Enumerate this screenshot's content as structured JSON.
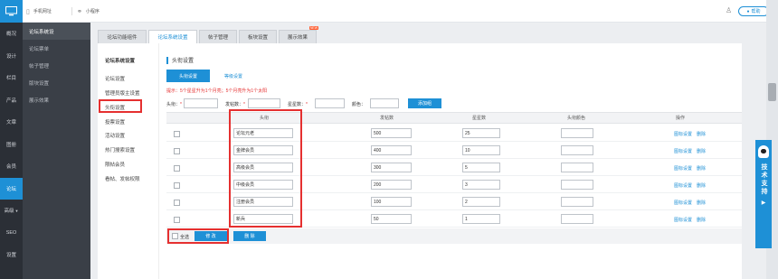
{
  "nav": {
    "items": [
      "概况",
      "设计",
      "栏目",
      "产品",
      "文章",
      "图册",
      "会员",
      "论坛",
      "高级",
      "SEO",
      "设置"
    ],
    "active_index": 7
  },
  "sub_nav": {
    "title": "论坛",
    "items": [
      "论坛系统设",
      "论坛票单",
      "帖子管理",
      "版块设置",
      "展示效果"
    ],
    "active_index": 0
  },
  "topbar": {
    "mobile_label": "手机网址",
    "miniapp_label": "小程序",
    "help_label": "帮助"
  },
  "tabs": [
    {
      "label": "论坛功能组件"
    },
    {
      "label": "论坛系统设置"
    },
    {
      "label": "帖子管理"
    },
    {
      "label": "板块设置"
    },
    {
      "label": "展示效果",
      "badge": "NEW"
    }
  ],
  "active_tab": 1,
  "left_menu": {
    "title": "论坛系统设置",
    "items": [
      "论坛设置",
      "管理员版主设置",
      "头衔设置",
      "投票设置",
      "活动设置",
      "热门搜索设置",
      "限帖会员",
      "看帖、发帖权限"
    ],
    "active_index": 2
  },
  "section": {
    "title": "头衔设置",
    "subtabs": [
      "头衔设置",
      "等级设置"
    ],
    "hint": "提示：5个星星升为1个月亮；5个月亮升为1个太阳"
  },
  "form": {
    "title_label": "头衔：",
    "posts_label": "发帖数：",
    "stars_label": "星星数：",
    "color_label": "颜色：",
    "add_button": "添加组"
  },
  "table": {
    "headers": [
      "头衔",
      "发帖数",
      "星星数",
      "头衔颜色",
      "操作"
    ],
    "rows": [
      {
        "title": "论坛元老",
        "posts": "500",
        "stars": "25"
      },
      {
        "title": "金牌会员",
        "posts": "400",
        "stars": "10"
      },
      {
        "title": "高级会员",
        "posts": "300",
        "stars": "5"
      },
      {
        "title": "中级会员",
        "posts": "200",
        "stars": "3"
      },
      {
        "title": "注册会员",
        "posts": "100",
        "stars": "2"
      },
      {
        "title": "新兵",
        "posts": "50",
        "stars": "1"
      }
    ],
    "op_icon": "图标设置",
    "op_delete": "删除"
  },
  "footer": {
    "select_all": "全选",
    "modify_button": "修 改",
    "delete_button": "删 除"
  },
  "support": {
    "label": "技术支持"
  },
  "colors": {
    "primary": "#1e90d6",
    "nav_bg": "#2b2f36",
    "highlight": "#e53030"
  }
}
